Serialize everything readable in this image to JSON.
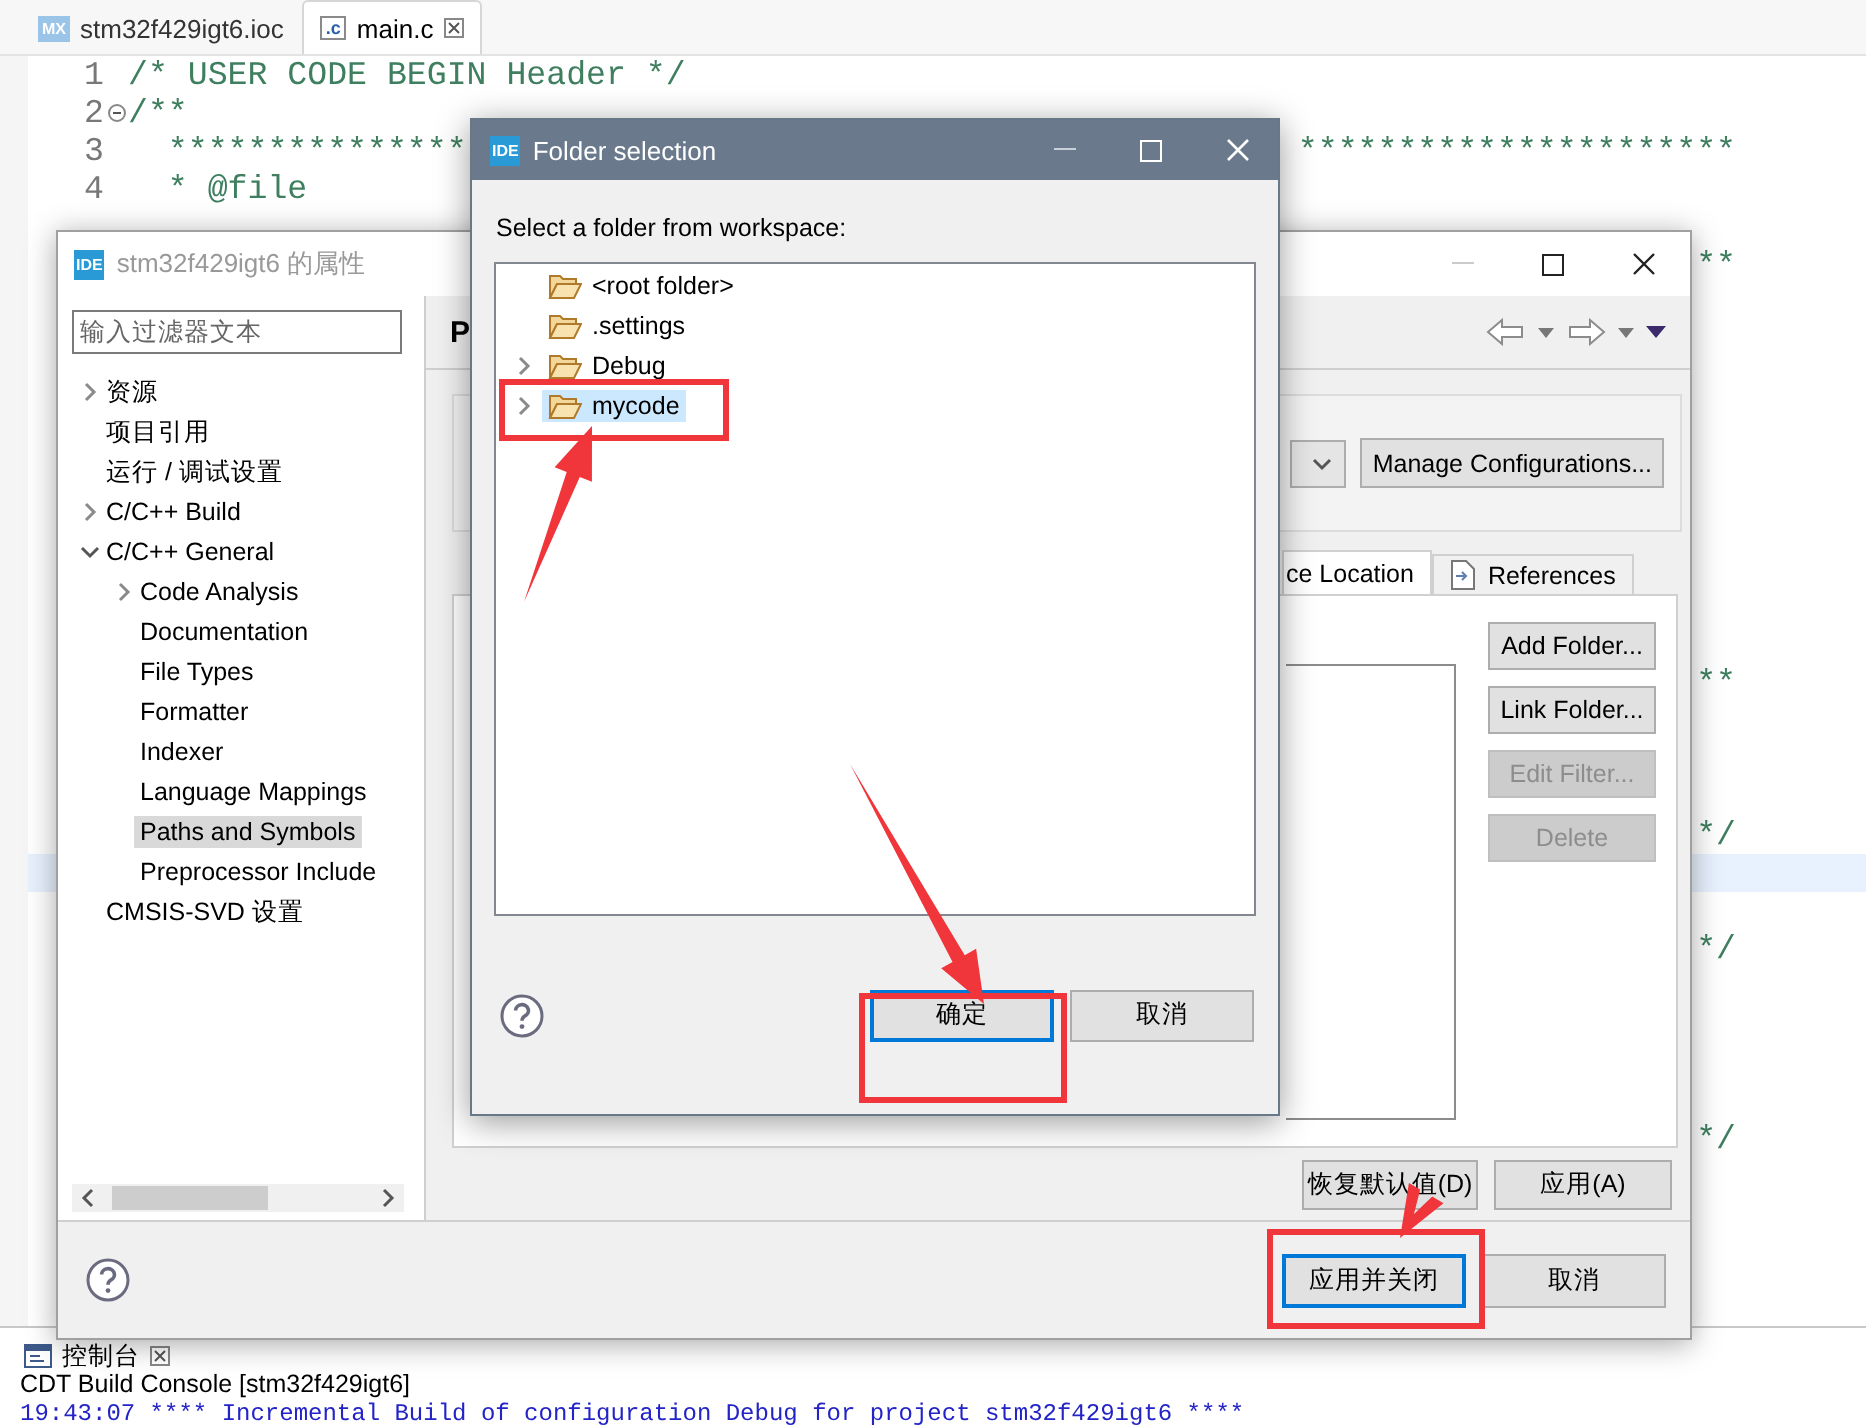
{
  "editor": {
    "tabs": [
      {
        "label": "stm32f429igt6.ioc",
        "badge": "MX",
        "kind": "mx",
        "selected": false
      },
      {
        "label": "main.c",
        "badge": ".c",
        "kind": "c",
        "selected": true
      }
    ],
    "lines": [
      {
        "number": "1",
        "text": "/* USER CODE BEGIN Header */",
        "fold": false,
        "current": false
      },
      {
        "number": "2",
        "text": "/**",
        "fold": true,
        "current": false
      },
      {
        "number": "3",
        "text": "  ***************",
        "tail": "**********************",
        "fold": false,
        "current": false
      },
      {
        "number": "4",
        "text": "  * @file",
        "fold": false,
        "current": false
      },
      {
        "fold": false,
        "current": false
      },
      {
        "tail": "**",
        "fold": false,
        "current": false
      },
      {
        "fold": false,
        "current": false
      },
      {
        "fold": false,
        "current": false
      },
      {
        "fold": false,
        "current": false
      },
      {
        "fold": false,
        "current": false
      },
      {
        "fold": false,
        "current": false
      },
      {
        "fold": false,
        "current": false
      },
      {
        "fold": false,
        "current": false
      },
      {
        "fold": false,
        "current": false
      },
      {
        "fold": false,
        "current": false
      },
      {
        "fold": false,
        "current": false
      },
      {
        "tail": "**",
        "fold": false,
        "current": false
      },
      {
        "fold": false,
        "current": false
      },
      {
        "fold": false,
        "current": false
      },
      {
        "fold": false,
        "current": false
      },
      {
        "tail": "*/",
        "fold": false,
        "current": false
      },
      {
        "fold": false,
        "current": true
      },
      {
        "fold": false,
        "current": false
      },
      {
        "tail": "*/",
        "fold": false,
        "current": false
      },
      {
        "fold": false,
        "current": false
      },
      {
        "fold": false,
        "current": false
      },
      {
        "fold": false,
        "current": false
      },
      {
        "fold": false,
        "current": false
      },
      {
        "tail": "*/",
        "fold": false,
        "current": false
      }
    ]
  },
  "console": {
    "tab": "控制台",
    "title": "CDT Build Console [stm32f429igt6]",
    "lines": [
      "19:43:07 **** Incremental Build of configuration Debug for project stm32f429igt6 ****"
    ]
  },
  "properties_dialog": {
    "icon_text": "IDE",
    "title": "stm32f429igt6 的属性",
    "filter": {
      "placeholder": "输入过滤器文本"
    },
    "tree": [
      {
        "label": "资源",
        "expanded": false,
        "selected": false
      },
      {
        "label": "项目引用",
        "selected": false
      },
      {
        "label": "运行 / 调试设置",
        "selected": false
      },
      {
        "label": "C/C++ Build",
        "expanded": false,
        "selected": false
      },
      {
        "label": "C/C++ General",
        "expanded": true,
        "selected": false,
        "children": [
          {
            "label": "Code Analysis",
            "expanded": false,
            "selected": false
          },
          {
            "label": "Documentation",
            "selected": false
          },
          {
            "label": "File Types",
            "selected": false
          },
          {
            "label": "Formatter",
            "selected": false
          },
          {
            "label": "Indexer",
            "selected": false
          },
          {
            "label": "Language Mappings",
            "selected": false
          },
          {
            "label": "Paths and Symbols",
            "selected": true
          },
          {
            "label": "Preprocessor Include",
            "selected": false
          }
        ]
      },
      {
        "label": "CMSIS-SVD 设置",
        "selected": false
      }
    ],
    "panel_title": "P",
    "manage_button": "Manage Configurations...",
    "tabs": [
      {
        "label": "ce Location",
        "selected": true
      },
      {
        "label": "References",
        "selected": false
      }
    ],
    "side_buttons": [
      {
        "label": "Add Folder...",
        "disabled": false
      },
      {
        "label": "Link Folder...",
        "disabled": false
      },
      {
        "label": "Edit Filter...",
        "disabled": true
      },
      {
        "label": "Delete",
        "disabled": true
      }
    ],
    "panel_buttons": [
      "恢复默认值(D)",
      "应用(A)"
    ],
    "footer_buttons": [
      {
        "label": "应用并关闭",
        "default": true
      },
      {
        "label": "取消",
        "default": false
      }
    ]
  },
  "folder_dialog": {
    "icon_text": "IDE",
    "title": "Folder selection",
    "prompt": "Select a folder from workspace:",
    "tree": [
      {
        "label": "<root folder>",
        "selected": false
      },
      {
        "label": ".settings",
        "selected": false
      },
      {
        "label": "Debug",
        "expanded": false,
        "selected": false
      },
      {
        "label": "mycode",
        "expanded": false,
        "selected": true
      }
    ],
    "buttons": [
      {
        "label": "确定",
        "default": true
      },
      {
        "label": "取消",
        "default": false
      }
    ]
  }
}
